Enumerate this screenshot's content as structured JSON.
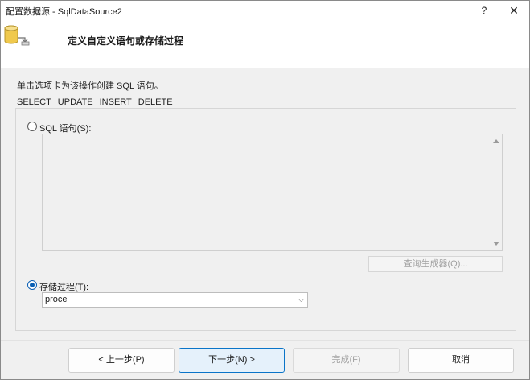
{
  "window": {
    "title": "配置数据源 - SqlDataSource2",
    "help_label": "?",
    "close_label": "✕"
  },
  "header": {
    "heading": "定义自定义语句或存储过程",
    "icon": "database-icon"
  },
  "instruction": "单击选项卡为该操作创建 SQL 语句。",
  "tabs": [
    "SELECT",
    "UPDATE",
    "INSERT",
    "DELETE"
  ],
  "sql_option": {
    "label": "SQL 语句(S):",
    "checked": false
  },
  "query_builder_label": "查询生成器(Q)...",
  "proc_option": {
    "label": "存储过程(T):",
    "checked": true
  },
  "proc_select": {
    "value": "proce"
  },
  "buttons": {
    "prev": "< 上一步(P)",
    "next": "下一步(N) >",
    "finish": "完成(F)",
    "cancel": "取消"
  }
}
